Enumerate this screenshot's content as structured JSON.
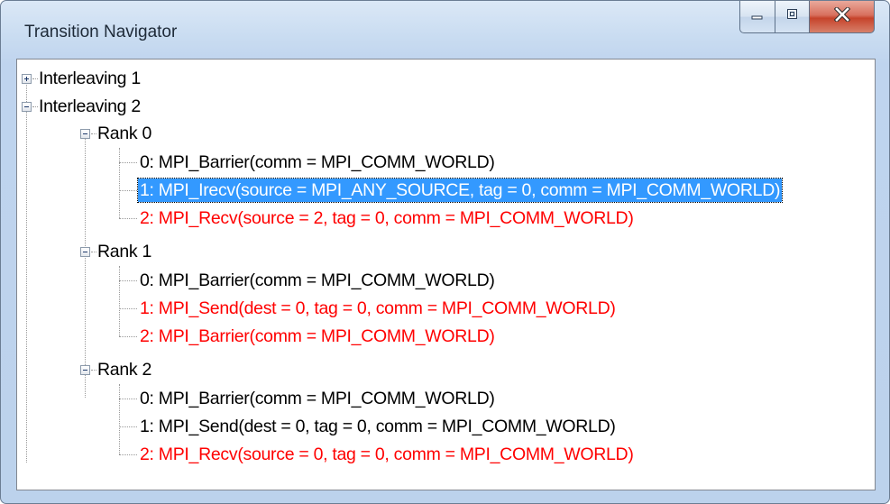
{
  "window": {
    "title": "Transition Navigator",
    "buttons": {
      "minimize": "minimize-icon",
      "maximize": "maximize-icon",
      "close": "close-icon"
    }
  },
  "colors": {
    "selection": "#3399ff",
    "highlight_text": "#ff0000"
  },
  "tree": {
    "interleaving_1": "Interleaving 1",
    "interleaving_2": "Interleaving 2",
    "ranks": [
      {
        "label": "Rank 0",
        "items": [
          {
            "text": "0: MPI_Barrier(comm = MPI_COMM_WORLD)"
          },
          {
            "text": "1: MPI_Irecv(source = MPI_ANY_SOURCE, tag = 0, comm = MPI_COMM_WORLD)"
          },
          {
            "text": "2: MPI_Recv(source = 2, tag = 0, comm = MPI_COMM_WORLD)"
          }
        ]
      },
      {
        "label": "Rank 1",
        "items": [
          {
            "text": "0: MPI_Barrier(comm = MPI_COMM_WORLD)"
          },
          {
            "text": "1: MPI_Send(dest = 0, tag = 0, comm = MPI_COMM_WORLD)"
          },
          {
            "text": "2: MPI_Barrier(comm = MPI_COMM_WORLD)"
          }
        ]
      },
      {
        "label": "Rank 2",
        "items": [
          {
            "text": "0: MPI_Barrier(comm = MPI_COMM_WORLD)"
          },
          {
            "text": "1: MPI_Send(dest = 0, tag = 0, comm = MPI_COMM_WORLD)"
          },
          {
            "text": "2: MPI_Recv(source = 0, tag = 0, comm = MPI_COMM_WORLD)"
          }
        ]
      }
    ]
  }
}
